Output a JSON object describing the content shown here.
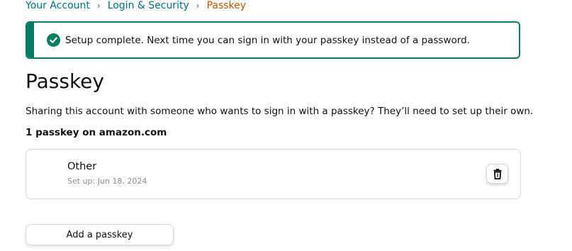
{
  "breadcrumb": {
    "items": [
      "Your Account",
      "Login & Security"
    ],
    "current": "Passkey",
    "separator": "›"
  },
  "alert": {
    "message": "Setup complete. Next time you can sign in with your passkey instead of a password.",
    "icon": "check-circle-icon",
    "color": "#067d62"
  },
  "page": {
    "title": "Passkey",
    "description": "Sharing this account with someone who wants to sign in with a passkey? They’ll need to set up their own.",
    "count_label": "1 passkey on amazon.com"
  },
  "passkeys": [
    {
      "name": "Other",
      "setup": "Set up: Jun 18, 2024",
      "delete_icon": "trash-icon"
    }
  ],
  "actions": {
    "add_label": "Add a passkey"
  },
  "colors": {
    "link": "#007185",
    "current": "#c45500",
    "text": "#0f1111",
    "border": "#d5d9d9"
  }
}
